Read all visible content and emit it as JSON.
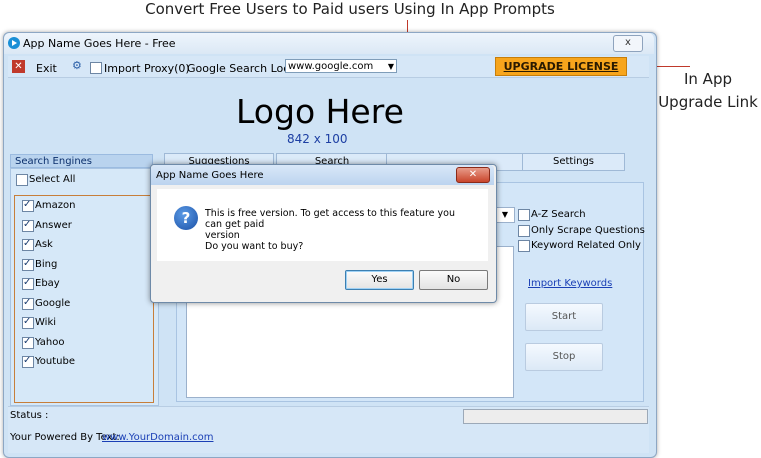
{
  "annotations": {
    "top": "Convert Free Users to Paid users Using In App Prompts",
    "right_line1": "In App",
    "right_line2": "Upgrade Link"
  },
  "window": {
    "title": "App Name Goes Here - Free",
    "close_glyph": "x"
  },
  "toolbar": {
    "exit_label": "Exit",
    "import_proxy_label": "Import Proxy(0)",
    "search_location_label": "Google Search Location :",
    "search_location_value": "www.google.com",
    "upgrade_label": "UPGRADE LICENSE"
  },
  "logo": {
    "title": "Logo Here",
    "size": "842 x 100"
  },
  "search_engines": {
    "header": "Search Engines",
    "select_all": "Select All",
    "items": [
      "Amazon",
      "Answer",
      "Ask",
      "Bing",
      "Ebay",
      "Google",
      "Wiki",
      "Yahoo",
      "Youtube"
    ]
  },
  "tabs": [
    "Suggestions",
    "Search",
    "Settings"
  ],
  "options": {
    "az_search": "A-Z Search",
    "only_scrape": "Only Scrape Questions",
    "keyword_related": "Keyword Related Only",
    "import_keywords": "Import Keywords",
    "start": "Start",
    "stop": "Stop"
  },
  "status": {
    "label": "Status :",
    "powered_by": "Your Powered By Text:",
    "domain": "www.YourDomain.com",
    "progress": 0
  },
  "dialog": {
    "title": "App Name Goes Here",
    "message_line1": "This is free version. To get access to this feature you can get paid",
    "message_line2": "version",
    "message_line3": "Do you want to buy?",
    "yes": "Yes",
    "no": "No"
  },
  "colors": {
    "upgrade_bg": "#f7a51c",
    "arrow": "#c0392b",
    "window_bg": "#cfe3f5"
  }
}
